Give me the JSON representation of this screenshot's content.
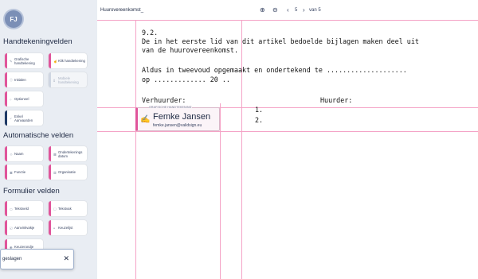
{
  "user": {
    "initials": "FJ"
  },
  "sections": {
    "signature": "Handtekeningvelden",
    "automatic": "Automatische velden",
    "form": "Formulier velden"
  },
  "signature_fields": [
    {
      "label": "Grafische handtekening",
      "icon": "signature-icon"
    },
    {
      "label": "Klik handtekening",
      "icon": "click-icon"
    },
    {
      "label": "Initialen",
      "icon": "initials-icon"
    },
    {
      "label": "Mobiele handtekening",
      "icon": "mobile-icon",
      "disabled": true
    },
    {
      "label": "Optioneel",
      "icon": "optional-icon"
    },
    {
      "label": "Enkel Aanvaarden",
      "icon": "accept-icon"
    }
  ],
  "automatic_fields": [
    {
      "label": "Naam",
      "icon": "person-icon"
    },
    {
      "label": "Ondertekenings datum",
      "icon": "calendar-icon"
    },
    {
      "label": "Functie",
      "icon": "briefcase-icon"
    },
    {
      "label": "Organisatie",
      "icon": "building-icon"
    }
  ],
  "form_fields": [
    {
      "label": "Tekstveld",
      "icon": "textfield-icon"
    },
    {
      "label": "Tekstvak",
      "icon": "textbox-icon"
    },
    {
      "label": "Aanvinkvakje",
      "icon": "checkbox-icon"
    },
    {
      "label": "Keuzelijst",
      "icon": "list-icon"
    },
    {
      "label": "Keuzerondje",
      "icon": "radio-icon"
    }
  ],
  "toast": {
    "message": "geslagen",
    "close": "✕"
  },
  "toolbar": {
    "title": "Huurovereenkomst_",
    "zoom_in": "⊕",
    "zoom_out": "⊖",
    "prev": "‹",
    "next": "›",
    "page": "5",
    "of": "van 5"
  },
  "document": {
    "line1": "9.2.",
    "line2": "De in het eerste lid van dit artikel bedoelde bijlagen maken deel uit",
    "line3": "van de huurovereenkomst.",
    "line4": "Aldus in tweevoud opgemaakt en ondertekend te ....................",
    "line5": "op ............. 20 ..",
    "verhuurder": "Verhuurder:",
    "huurder": "Huurder:",
    "h1": "1.",
    "h2": "2."
  },
  "signature_box": {
    "tag": "GRAFISCHE HANDTEKENING",
    "name": "Femke Jansen",
    "email": "femke.jansen@validsign.eu"
  }
}
